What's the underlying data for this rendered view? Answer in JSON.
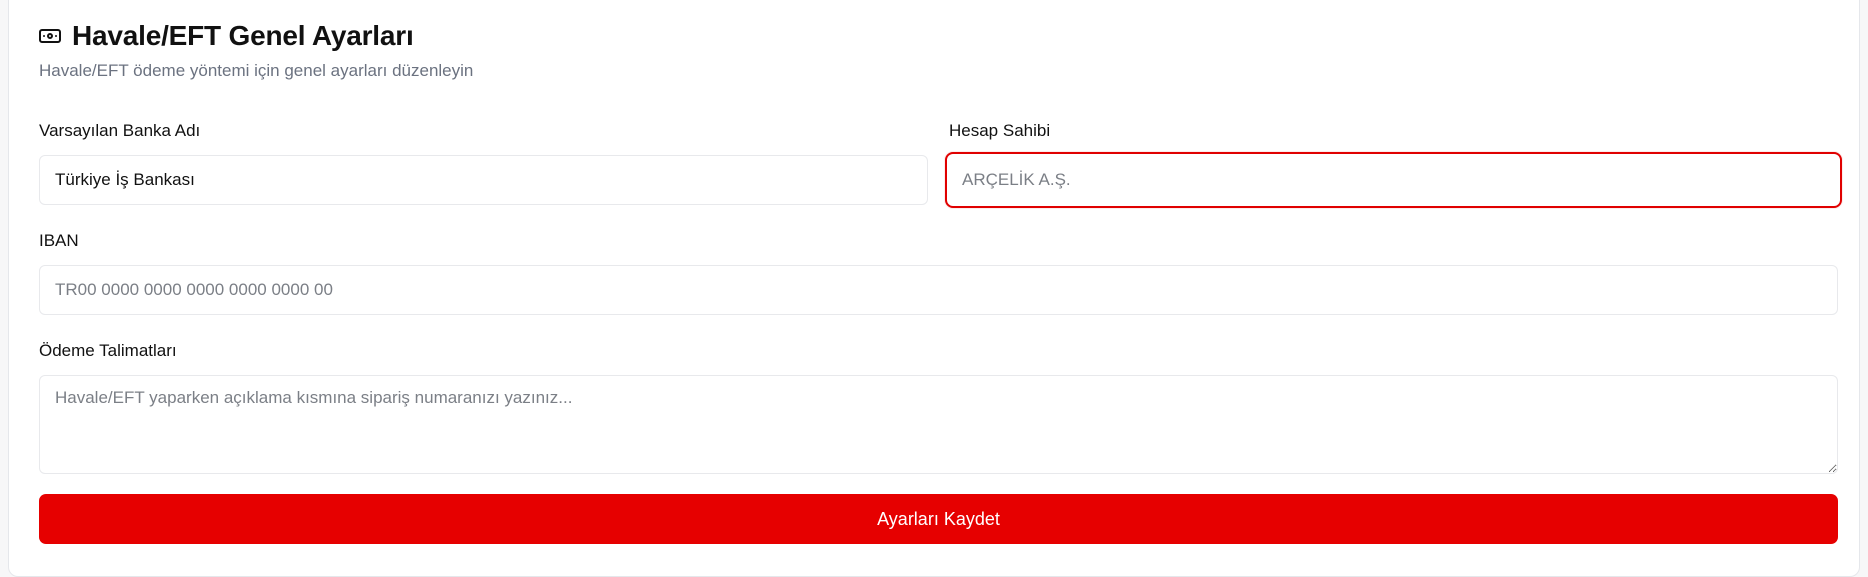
{
  "header": {
    "icon": "banknote-icon",
    "title": "Havale/EFT Genel Ayarları",
    "subtitle": "Havale/EFT ödeme yöntemi için genel ayarları düzenleyin"
  },
  "form": {
    "bank_name": {
      "label": "Varsayılan Banka Adı",
      "value": "Türkiye İş Bankası",
      "placeholder": ""
    },
    "account_holder": {
      "label": "Hesap Sahibi",
      "value": "",
      "placeholder": "ARÇELİK A.Ş."
    },
    "iban": {
      "label": "IBAN",
      "value": "",
      "placeholder": "TR00 0000 0000 0000 0000 0000 00"
    },
    "payment_instructions": {
      "label": "Ödeme Talimatları",
      "value": "",
      "placeholder": "Havale/EFT yaparken açıklama kısmına sipariş numaranızı yazınız..."
    },
    "save_label": "Ayarları Kaydet"
  },
  "colors": {
    "accent": "#e60000",
    "focus_border": "#e00000",
    "muted_text": "#6b7280"
  }
}
